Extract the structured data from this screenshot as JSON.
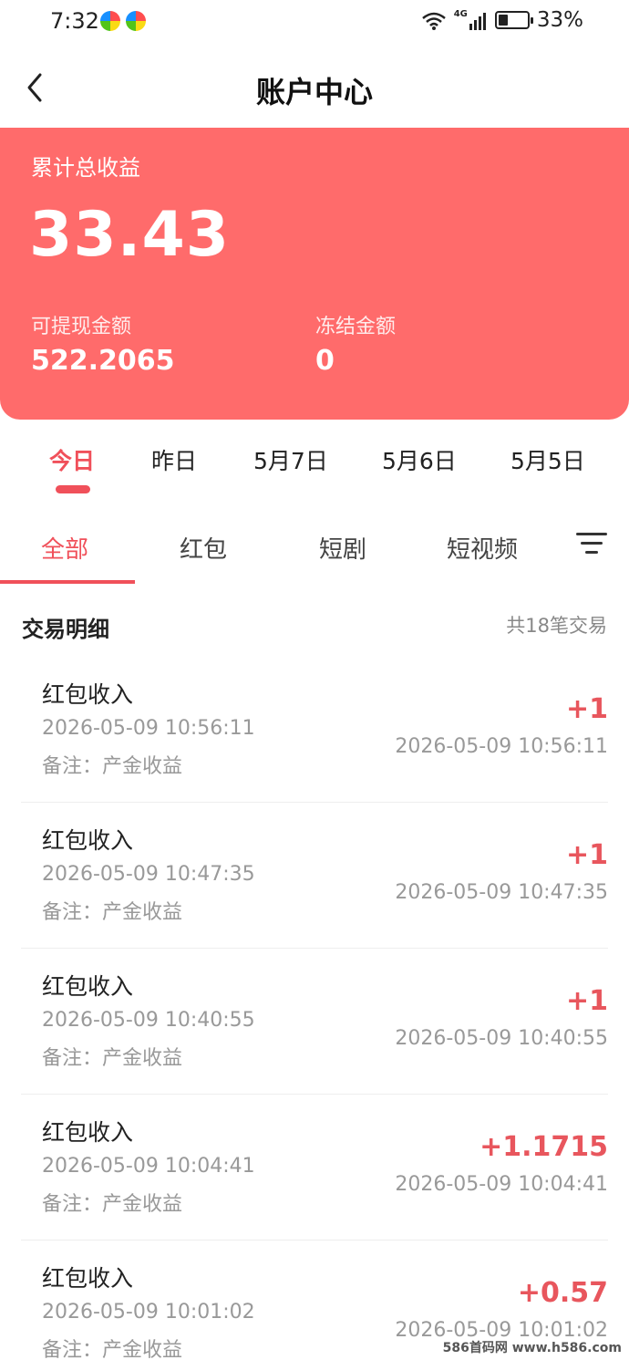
{
  "status_bar": {
    "time": "7:32",
    "network": "4G",
    "battery_percent": "33%",
    "battery_level": 0.33
  },
  "header": {
    "title": "账户中心"
  },
  "summary": {
    "total_label": "累计总收益",
    "total_value": "33.43",
    "available_label": "可提现金额",
    "available_value": "522.2065",
    "frozen_label": "冻结金额",
    "frozen_value": "0"
  },
  "date_tabs": [
    {
      "label": "今日",
      "active": true
    },
    {
      "label": "昨日",
      "active": false
    },
    {
      "label": "5月7日",
      "active": false
    },
    {
      "label": "5月6日",
      "active": false
    },
    {
      "label": "5月5日",
      "active": false
    }
  ],
  "category_tabs": [
    {
      "label": "全部",
      "active": true
    },
    {
      "label": "红包",
      "active": false
    },
    {
      "label": "短剧",
      "active": false
    },
    {
      "label": "短视频",
      "active": false
    }
  ],
  "section": {
    "title": "交易明细",
    "count": "共18笔交易"
  },
  "transactions": [
    {
      "title": "红包收入",
      "time": "2026-05-09 10:56:11",
      "note": "备注：产金收益",
      "amount": "+1",
      "time_right": "2026-05-09 10:56:11"
    },
    {
      "title": "红包收入",
      "time": "2026-05-09 10:47:35",
      "note": "备注：产金收益",
      "amount": "+1",
      "time_right": "2026-05-09 10:47:35"
    },
    {
      "title": "红包收入",
      "time": "2026-05-09 10:40:55",
      "note": "备注：产金收益",
      "amount": "+1",
      "time_right": "2026-05-09 10:40:55"
    },
    {
      "title": "红包收入",
      "time": "2026-05-09 10:04:41",
      "note": "备注：产金收益",
      "amount": "+1.1715",
      "time_right": "2026-05-09 10:04:41"
    },
    {
      "title": "红包收入",
      "time": "2026-05-09 10:01:02",
      "note": "备注：产金收益",
      "amount": "+0.57",
      "time_right": "2026-05-09 10:01:02"
    }
  ],
  "watermark": "586首码网 www.h586.com",
  "colors": {
    "accent": "#f0505a",
    "card": "#ff6b6b",
    "amount": "#e8565d"
  }
}
